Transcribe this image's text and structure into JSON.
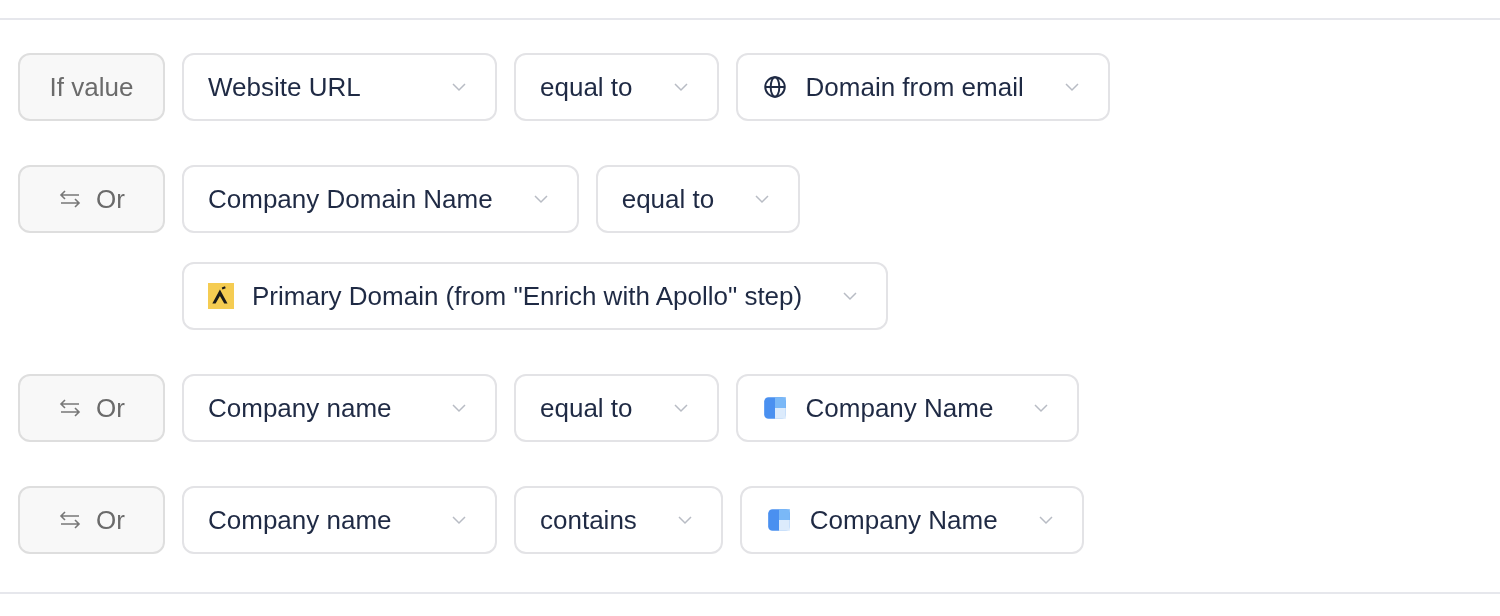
{
  "conditions": [
    {
      "kind": "if",
      "label": "If value",
      "fields": [
        {
          "kind": "plain",
          "value": "Website URL"
        },
        {
          "kind": "plain",
          "value": "equal to"
        },
        {
          "kind": "globe",
          "value": "Domain from email"
        }
      ]
    },
    {
      "kind": "or",
      "label": "Or",
      "fields": [
        {
          "kind": "plain",
          "value": "Company Domain Name"
        },
        {
          "kind": "plain",
          "value": "equal to"
        },
        {
          "kind": "apollo",
          "value": "Primary Domain (from \"Enrich with Apollo\" step)"
        }
      ]
    },
    {
      "kind": "or",
      "label": "Or",
      "fields": [
        {
          "kind": "plain",
          "value": "Company name"
        },
        {
          "kind": "plain",
          "value": "equal to"
        },
        {
          "kind": "app",
          "value": "Company Name"
        }
      ]
    },
    {
      "kind": "or",
      "label": "Or",
      "fields": [
        {
          "kind": "plain",
          "value": "Company name"
        },
        {
          "kind": "plain",
          "value": "contains"
        },
        {
          "kind": "app",
          "value": "Company Name"
        }
      ]
    }
  ]
}
